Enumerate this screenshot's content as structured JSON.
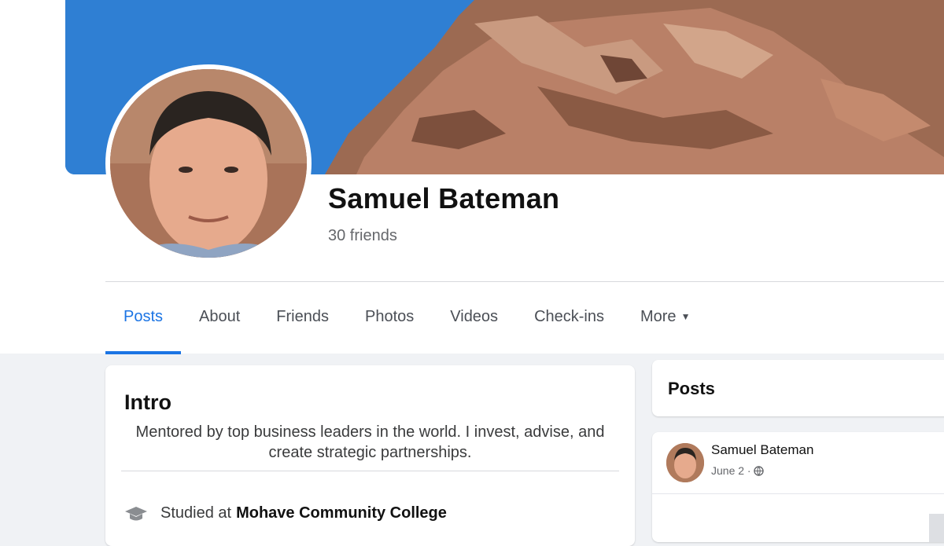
{
  "profile": {
    "name": "Samuel Bateman",
    "friends_count": "30 friends"
  },
  "tabs": [
    {
      "label": "Posts",
      "active": true
    },
    {
      "label": "About"
    },
    {
      "label": "Friends"
    },
    {
      "label": "Photos"
    },
    {
      "label": "Videos"
    },
    {
      "label": "Check-ins"
    },
    {
      "label": "More"
    }
  ],
  "intro": {
    "title": "Intro",
    "bio": "Mentored by top business leaders in the world. I invest, advise, and create strategic partnerships.",
    "education_prefix": "Studied at",
    "education_school": "Mohave Community College"
  },
  "posts": {
    "title": "Posts",
    "post": {
      "author": "Samuel Bateman",
      "date": "June 2 ·"
    }
  },
  "colors": {
    "accent": "#1b74e4",
    "sky": "#2f7fd3",
    "rock": "#a8705a",
    "page_bg": "#f0f2f5"
  },
  "icons": {
    "more_caret": "caret-down-icon",
    "education": "graduation-cap-icon",
    "privacy": "globe-icon"
  }
}
